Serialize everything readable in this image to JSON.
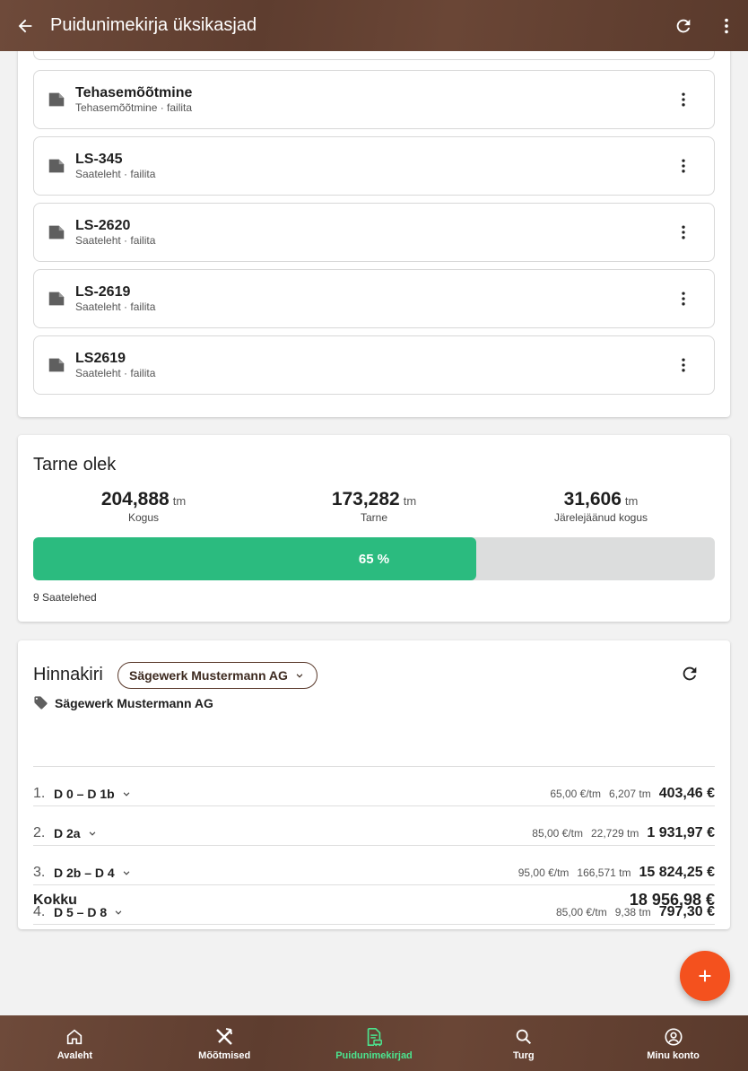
{
  "appbar": {
    "title": "Puidunimekirja üksikasjad",
    "back_icon": "arrow-left-icon",
    "refresh_icon": "refresh-icon",
    "menu_icon": "more-vert-icon"
  },
  "files": [
    {
      "name": "Tehasemõõtmine",
      "sub": "Tehasemõõtmine · failita"
    },
    {
      "name": "LS-345",
      "sub": "Saateleht · failita"
    },
    {
      "name": "LS-2620",
      "sub": "Saateleht · failita"
    },
    {
      "name": "LS-2619",
      "sub": "Saateleht · failita"
    },
    {
      "name": "LS2619",
      "sub": "Saateleht · failita"
    }
  ],
  "tarne": {
    "title": "Tarne olek",
    "stats": [
      {
        "value": "204,888",
        "unit": "tm",
        "label": "Kogus"
      },
      {
        "value": "173,282",
        "unit": "tm",
        "label": "Tarne"
      },
      {
        "value": "31,606",
        "unit": "tm",
        "label": "Järelejäänud kogus"
      }
    ],
    "progress_fraction": 0.65,
    "progress_label": "65 %",
    "saatelehed": "9 Saatelehed"
  },
  "hinnakiri": {
    "title": "Hinnakiri",
    "selected_buyer": "Sägewerk Mustermann AG",
    "buyer_name": "Sägewerk Mustermann AG",
    "rows": [
      {
        "idx": "1.",
        "cls": "D 0 – D 1b",
        "price": "65,00 €/tm",
        "vol": "6,207 tm",
        "sum": "403,46 €"
      },
      {
        "idx": "2.",
        "cls": "D 2a",
        "price": "85,00 €/tm",
        "vol": "22,729 tm",
        "sum": "1 931,97 €"
      },
      {
        "idx": "3.",
        "cls": "D 2b – D 4",
        "price": "95,00 €/tm",
        "vol": "166,571 tm",
        "sum": "15 824,25 €"
      },
      {
        "idx": "4.",
        "cls": "D 5 – D 8",
        "price": "85,00 €/tm",
        "vol": "9,38 tm",
        "sum": "797,30 €"
      }
    ],
    "total_label": "Kokku",
    "total_value": "18 956,98 €"
  },
  "nav": [
    {
      "label": "Avaleht",
      "icon": "home-icon"
    },
    {
      "label": "Mõõtmised",
      "icon": "hammer-pick-icon"
    },
    {
      "label": "Puidunimekirjad",
      "icon": "document-truck-icon",
      "active": true
    },
    {
      "label": "Turg",
      "icon": "search-icon"
    },
    {
      "label": "Minu konto",
      "icon": "account-circle-icon"
    }
  ],
  "colors": {
    "brand_brown": "#5e3d2f",
    "progress_green": "#2bbb7f",
    "fab_orange": "#f4511e",
    "nav_active": "#4be58f"
  }
}
